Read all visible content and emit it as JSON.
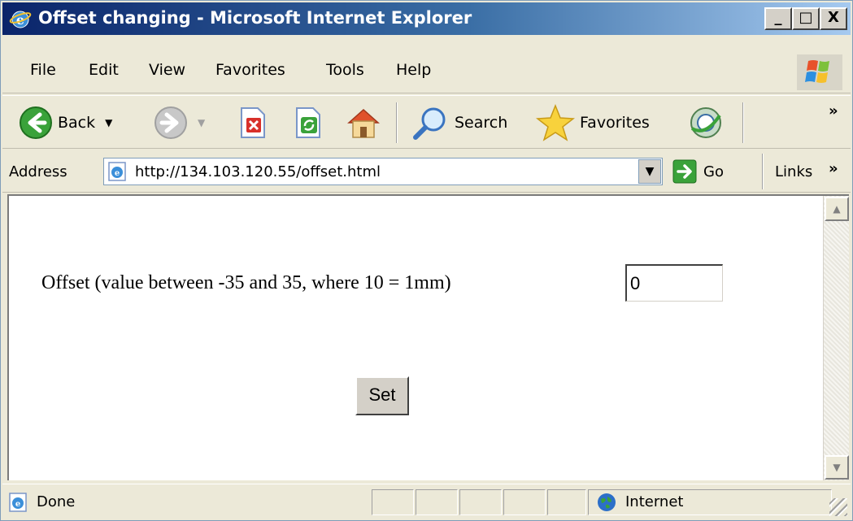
{
  "window": {
    "title": "Offset changing - Microsoft Internet Explorer",
    "caption_buttons": {
      "minimize": "_",
      "maximize": "□",
      "close": "X"
    }
  },
  "menu": {
    "items": [
      {
        "label": "File"
      },
      {
        "label": "Edit"
      },
      {
        "label": "View"
      },
      {
        "label": "Favorites"
      },
      {
        "label": "Tools"
      },
      {
        "label": "Help"
      }
    ]
  },
  "toolbar": {
    "back_label": "Back",
    "search_label": "Search",
    "favorites_label": "Favorites",
    "more": "»"
  },
  "address": {
    "label": "Address",
    "url": "http://134.103.120.55/offset.html",
    "go_label": "Go",
    "links_label": "Links",
    "links_more": "»"
  },
  "page": {
    "offset_label": "Offset (value between -35 and 35, where 10 = 1mm)",
    "offset_value": "0",
    "set_button": "Set"
  },
  "status": {
    "text": "Done",
    "zone": "Internet"
  },
  "colors": {
    "title_bar_start": "#0a246a",
    "title_bar_end": "#a6caf0",
    "chrome_bg": "#ece9d8"
  }
}
